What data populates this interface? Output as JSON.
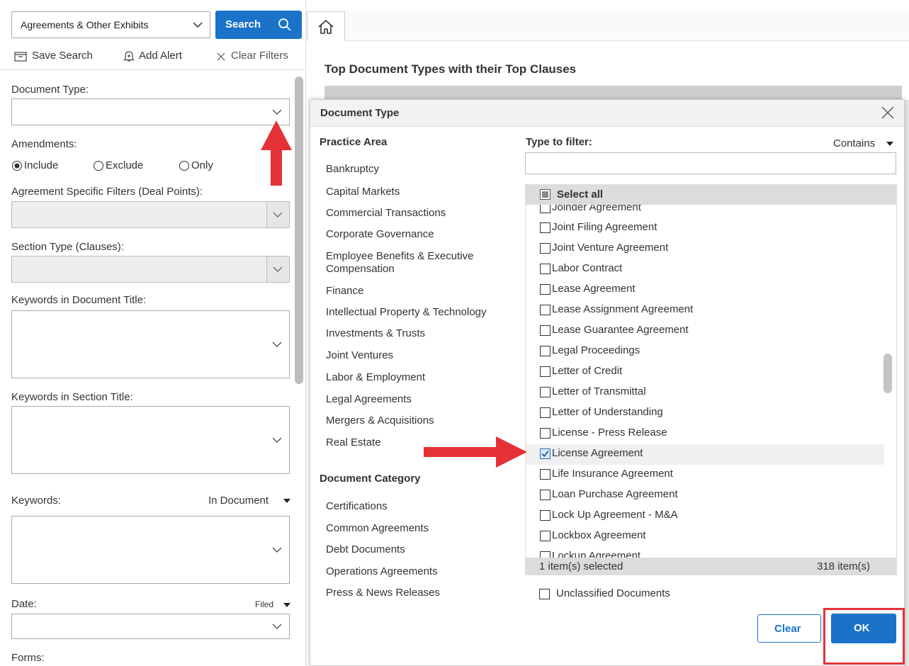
{
  "sidebar": {
    "collection_select": "Agreements & Other Exhibits",
    "search_button": "Search",
    "save_search": "Save Search",
    "add_alert": "Add Alert",
    "clear_filters": "Clear Filters",
    "document_type_label": "Document Type:",
    "amendments_label": "Amendments:",
    "amendments_options": [
      "Include",
      "Exclude",
      "Only"
    ],
    "agreement_filters_label": "Agreement Specific Filters (Deal Points):",
    "section_type_label": "Section Type (Clauses):",
    "keywords_doc_title_label": "Keywords in Document Title:",
    "keywords_section_title_label": "Keywords in Section Title:",
    "keywords_label": "Keywords:",
    "keywords_scope": "In Document",
    "date_label": "Date:",
    "date_scope": "Filed",
    "forms_label": "Forms:"
  },
  "main": {
    "heading": "Top Document Types with their Top Clauses"
  },
  "dialog": {
    "title": "Document Type",
    "practice_area_heading": "Practice Area",
    "practice_areas": [
      "Bankruptcy",
      "Capital Markets",
      "Commercial Transactions",
      "Corporate Governance",
      "Employee Benefits & Executive",
      "Compensation",
      "Finance",
      "Intellectual Property & Technology",
      "Investments & Trusts",
      "Joint Ventures",
      "Labor & Employment",
      "Legal Agreements",
      "Mergers & Acquisitions",
      "Real Estate"
    ],
    "document_category_heading": "Document Category",
    "document_categories": [
      "Certifications",
      "Common Agreements",
      "Debt Documents",
      "Operations Agreements",
      "Press & News Releases"
    ],
    "filter_label": "Type to filter:",
    "filter_mode": "Contains",
    "filter_value": "",
    "select_all": "Select all",
    "partial_top_item": "Joinder Agreement",
    "items": [
      "Joint Filing Agreement",
      "Joint Venture Agreement",
      "Labor Contract",
      "Lease Agreement",
      "Lease Assignment Agreement",
      "Lease Guarantee Agreement",
      "Legal Proceedings",
      "Letter of Credit",
      "Letter of Transmittal",
      "Letter of Understanding",
      "License - Press Release",
      "License Agreement",
      "Life Insurance Agreement",
      "Loan Purchase Agreement",
      "Lock Up Agreement - M&A",
      "Lockbox Agreement"
    ],
    "checked_item": "License Agreement",
    "partial_bottom_item": "Lockup Agreement",
    "selected_count": "1 item(s) selected",
    "total_count": "318 item(s)",
    "unclassified": "Unclassified Documents",
    "clear_button": "Clear",
    "ok_button": "OK"
  },
  "colors": {
    "accent": "#1a73c8",
    "annotation": "#e53238"
  }
}
